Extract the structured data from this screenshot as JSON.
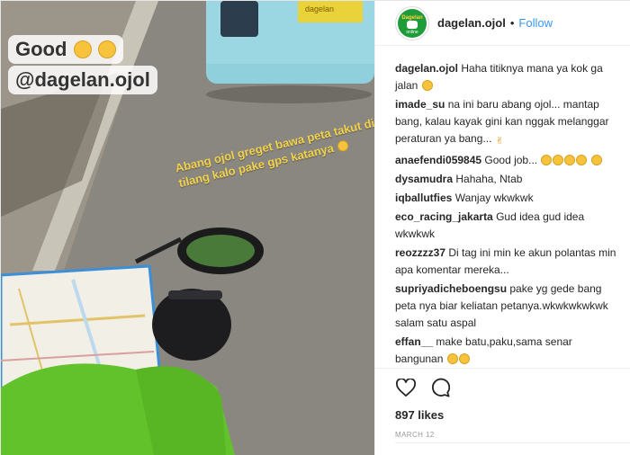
{
  "photo": {
    "sticker_line1": "Good",
    "sticker_line2": "@dagelan.ojol",
    "overlay_caption": "Abang ojol greget bawa peta takut di tilang kalo pake gps katanya",
    "truck_plate_text": "dagelan"
  },
  "account": {
    "avatar_top": "Dagelan",
    "avatar_bottom": "online",
    "username": "dagelan.ojol",
    "separator": "•",
    "follow_label": "Follow"
  },
  "comments": [
    {
      "user": "dagelan.ojol",
      "text": "Haha titiknya mana ya kok ga jalan",
      "emoji": [
        "face"
      ]
    },
    {
      "user": "imade_su",
      "text": "na ini baru abang ojol... mantap bang, kalau kayak gini kan nggak melanggar peraturan ya bang...",
      "emoji": [
        "peace"
      ]
    },
    {
      "user": "anaefendi059845",
      "text": "Good job...",
      "emoji": [
        "face",
        "face",
        "face",
        "face",
        "face"
      ]
    },
    {
      "user": "dysamudra",
      "text": "Hahaha, Ntab",
      "emoji": []
    },
    {
      "user": "iqballutfies",
      "text": "Wanjay wkwkwk",
      "emoji": []
    },
    {
      "user": "eco_racing_jakarta",
      "text": "Gud idea gud idea wkwkwk",
      "emoji": []
    },
    {
      "user": "reozzzz37",
      "text": "Di tag ini min ke akun polantas min apa komentar mereka...",
      "emoji": []
    },
    {
      "user": "supriyadicheboengsu",
      "text": "pake yg gede bang peta nya biar keliatan petanya.wkwkwkwkwk salam satu aspal",
      "emoji": []
    },
    {
      "user": "effan__",
      "text": "make batu,paku,sama senar bangunan",
      "emoji": [
        "face",
        "face"
      ]
    }
  ],
  "actions": {
    "like_icon": "heart-icon",
    "comment_icon": "comment-bubble-icon",
    "likes_text": "897 likes",
    "date_text": "MARCH 12"
  },
  "colors": {
    "follow_blue": "#3897f0",
    "jacket_green": "#62c22c",
    "map_blue": "#3c8fd6",
    "caption_yellow": "#f2d24a"
  }
}
